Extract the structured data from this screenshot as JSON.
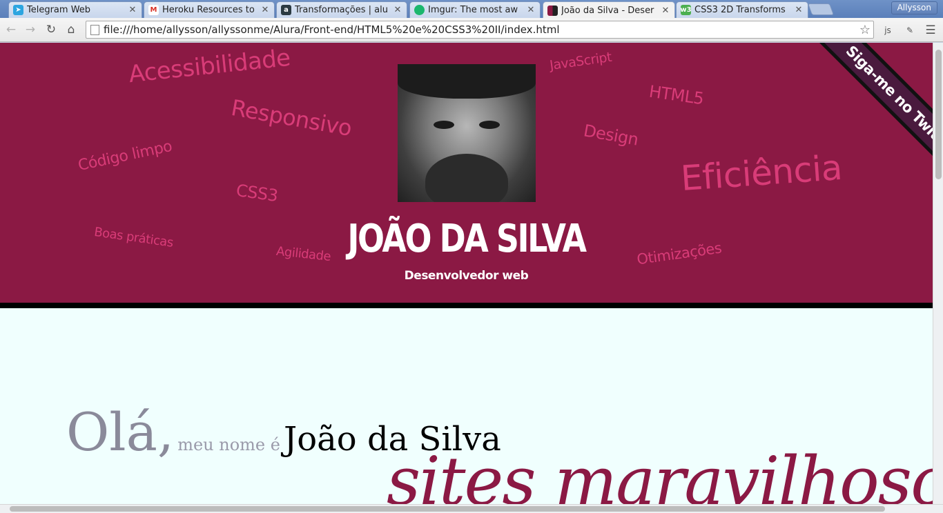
{
  "browser": {
    "tabs": [
      {
        "label": "Telegram Web",
        "icon": "telegram-icon",
        "color": "#2ca5e0"
      },
      {
        "label": "Heroku Resources to",
        "icon": "gmail-icon",
        "color": "#d93025"
      },
      {
        "label": "Transformações | alu",
        "icon": "alura-icon",
        "color": "#2b3a42"
      },
      {
        "label": "Imgur: The most aw",
        "icon": "imgur-icon",
        "color": "#1bb76e"
      },
      {
        "label": "João da Silva - Deser",
        "icon": "page-favicon-icon",
        "color": "#8b1944"
      },
      {
        "label": "CSS3 2D Transforms",
        "icon": "w3schools-icon",
        "color": "#4caf50"
      }
    ],
    "user": "Allysson",
    "url": "file:///home/allysson/allyssonme/Alura/Front-end/HTML5%20e%20CSS3%20II/index.html",
    "ext_label": "js"
  },
  "header": {
    "tags": [
      {
        "text": "Acessibilidade",
        "size": 34,
        "rot": -8
      },
      {
        "text": "Responsivo",
        "size": 32,
        "rot": 10
      },
      {
        "text": "Código limpo",
        "size": 22,
        "rot": -12
      },
      {
        "text": "CSS3",
        "size": 24,
        "rot": 8
      },
      {
        "text": "Boas práticas",
        "size": 18,
        "rot": 8
      },
      {
        "text": "Agilidade",
        "size": 18,
        "rot": 6
      },
      {
        "text": "JavaScript",
        "size": 20,
        "rot": -8
      },
      {
        "text": "HTML5",
        "size": 24,
        "rot": 8
      },
      {
        "text": "Design",
        "size": 24,
        "rot": 10
      },
      {
        "text": "Eficiência",
        "size": 52,
        "rot": -4
      },
      {
        "text": "Otimizações",
        "size": 22,
        "rot": -8
      }
    ],
    "name": "JOÃO DA SILVA",
    "role": "Desenvolvedor web",
    "ribbon": "Siga-me no Twitter"
  },
  "intro": {
    "ola": "Olá,",
    "meu_nome": "meu nome é",
    "name": "João da Silva",
    "partial": "sites maravilhosos"
  },
  "colors": {
    "header_bg": "#8b1944",
    "tag": "#d93c78",
    "page_bg": "#f0fffe"
  }
}
